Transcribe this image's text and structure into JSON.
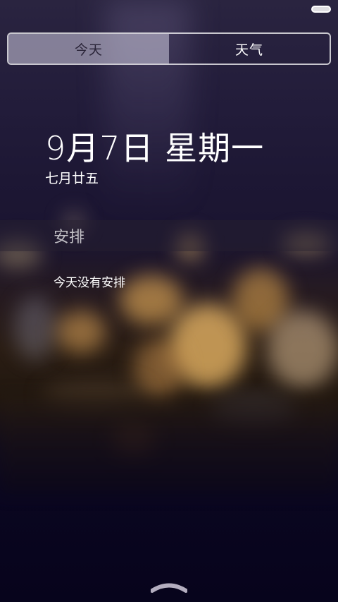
{
  "tabs": [
    {
      "label": "今天",
      "active": true
    },
    {
      "label": "天气",
      "active": false
    }
  ],
  "date": {
    "main": "9月7日 星期一",
    "lunar": "七月廿五"
  },
  "schedule": {
    "header": "安排",
    "empty_text": "今天没有安排"
  },
  "icons": {
    "battery": "battery-icon",
    "pull_handle": "chevron-up-icon"
  }
}
